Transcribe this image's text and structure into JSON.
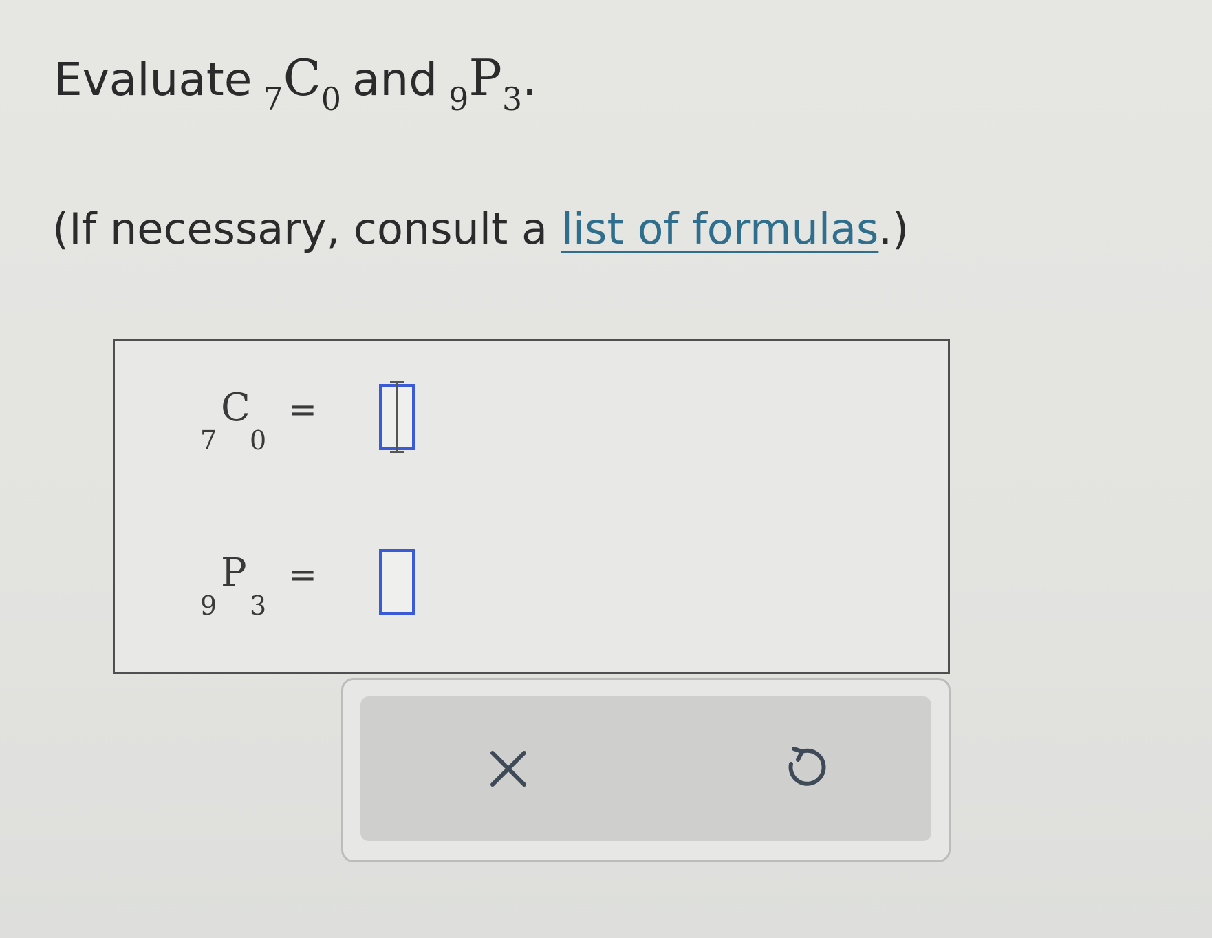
{
  "question": {
    "lead": "Evaluate",
    "combination": {
      "n": "7",
      "letter": "C",
      "r": "0"
    },
    "conjunction": "and",
    "permutation": {
      "n": "9",
      "letter": "P",
      "r": "3"
    },
    "end_punct": "."
  },
  "help": {
    "prefix": "(If necessary, consult a ",
    "link_text": "list of formulas",
    "suffix": ".)"
  },
  "answers": [
    {
      "n": "7",
      "letter": "C",
      "r": "0",
      "equals": "=",
      "value": ""
    },
    {
      "n": "9",
      "letter": "P",
      "r": "3",
      "equals": "=",
      "value": ""
    }
  ],
  "toolbar": {
    "clear_icon": "close-icon",
    "undo_icon": "undo-icon"
  },
  "colors": {
    "input_border": "#3b5bd6",
    "link": "#2f6f8d"
  }
}
